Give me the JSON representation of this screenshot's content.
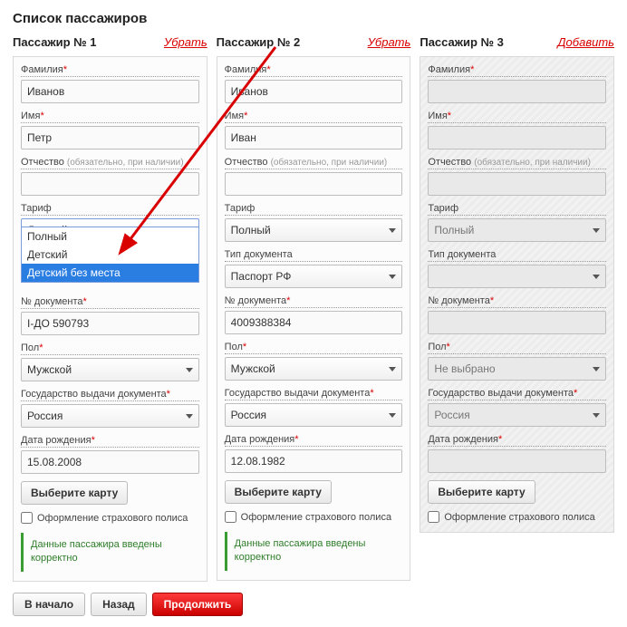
{
  "page_title": "Список пассажиров",
  "labels": {
    "surname": "Фамилия",
    "name": "Имя",
    "patronymic": "Отчество",
    "patronymic_hint": "(обязательно, при наличии)",
    "tariff": "Тариф",
    "doc_type": "Тип документа",
    "doc_no": "№ документа",
    "sex": "Пол",
    "country": "Государство выдачи документа",
    "dob": "Дата рождения",
    "select_card": "Выберите карту",
    "insurance": "Оформление страхового полиса",
    "ok_msg": "Данные пассажира введены корректно"
  },
  "tariff_options": {
    "opt0": "Полный",
    "opt1": "Детский",
    "opt2": "Детский без места"
  },
  "passengers": [
    {
      "header": "Пассажир № 1",
      "action": "Убрать",
      "surname": "Иванов",
      "name": "Петр",
      "patronymic": "",
      "tariff": "Детский",
      "doc_type": "",
      "doc_no": "I-ДО 590793",
      "sex": "Мужской",
      "country": "Россия",
      "dob": "15.08.2008"
    },
    {
      "header": "Пассажир № 2",
      "action": "Убрать",
      "surname": "Иванов",
      "name": "Иван",
      "patronymic": "",
      "tariff": "Полный",
      "doc_type": "Паспорт РФ",
      "doc_no": "4009388384",
      "sex": "Мужской",
      "country": "Россия",
      "dob": "12.08.1982"
    },
    {
      "header": "Пассажир № 3",
      "action": "Добавить",
      "surname": "",
      "name": "",
      "patronymic": "",
      "tariff": "Полный",
      "doc_type": "",
      "doc_no": "",
      "sex": "Не выбрано",
      "country": "Россия",
      "dob": ""
    }
  ],
  "nav": {
    "start": "В начало",
    "back": "Назад",
    "continue": "Продолжить"
  }
}
